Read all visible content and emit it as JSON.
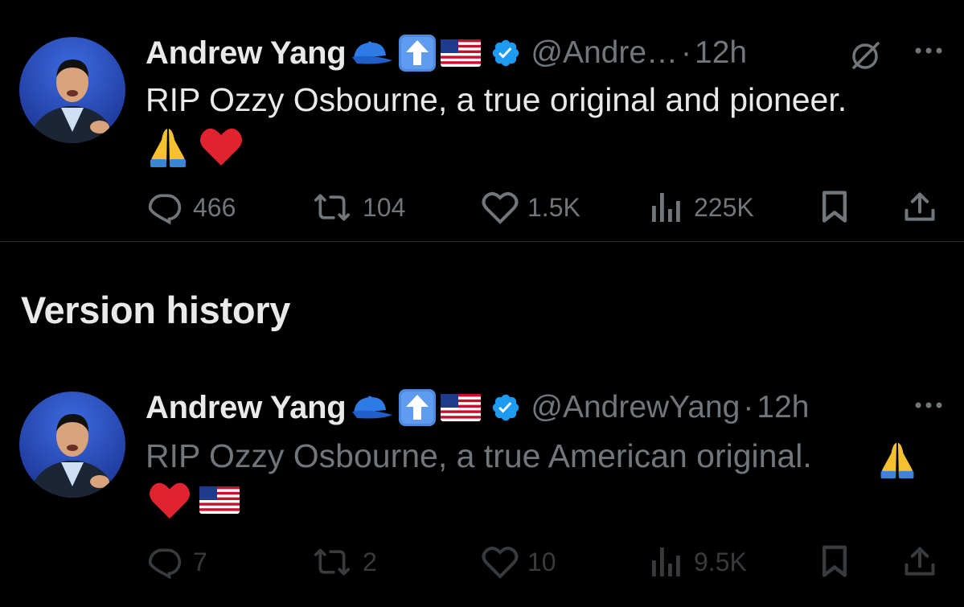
{
  "current_post": {
    "display_name": "Andrew Yang",
    "handle": "@Andre…",
    "dot": "·",
    "time": "12h",
    "text": "RIP Ozzy Osbourne, a true original and pioneer.",
    "stats": {
      "replies": "466",
      "reposts": "104",
      "likes": "1.5K",
      "views": "225K"
    }
  },
  "section_title": "Version history",
  "previous_version": {
    "display_name": "Andrew Yang",
    "handle": "@AndrewYang",
    "dot": "·",
    "time": "12h",
    "text": "RIP Ozzy Osbourne, a true American original.",
    "stats": {
      "replies": "7",
      "reposts": "2",
      "likes": "10",
      "views": "9.5K"
    }
  },
  "name_emojis": [
    "blue-cap-icon",
    "up-arrow-icon",
    "us-flag-icon"
  ],
  "colors": {
    "background": "#000000",
    "text": "#e7e9ea",
    "muted": "#71767b",
    "verified": "#1d9bf0",
    "divider": "#2f3336"
  }
}
